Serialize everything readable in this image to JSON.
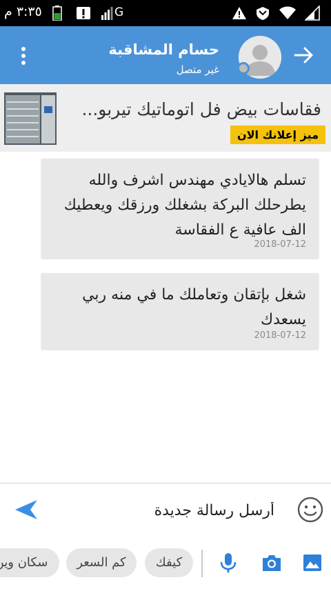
{
  "status_bar": {
    "time": "٣:٣٥ م",
    "network": "G"
  },
  "header": {
    "contact_name": "حسام المشاقبة",
    "contact_status": "غير متصل",
    "back_icon": "arrow-right-icon",
    "menu_icon": "more-vert-icon"
  },
  "ad": {
    "title": "فقاسات بيض فل اتوماتيك تيربو...",
    "cta": "ميز إعلانك الان",
    "cta_color": "#f4c20d"
  },
  "messages": [
    {
      "text": "تسلم هالايادي مهندس اشرف والله يطرحلك البركة بشغلك ورزقك ويعطيك الف عافية ع الفقاسة",
      "date": "2018-07-12"
    },
    {
      "text": "شغل بإتقان وتعاملك ما في منه ربي يسعدك",
      "date": "2018-07-12"
    }
  ],
  "composer": {
    "placeholder": "أرسل رسالة جديدة"
  },
  "quick_replies": [
    "كيفك",
    "كم السعر",
    "سكان وين"
  ],
  "colors": {
    "accent": "#4b93d8",
    "bubble": "#e8e8e8"
  }
}
